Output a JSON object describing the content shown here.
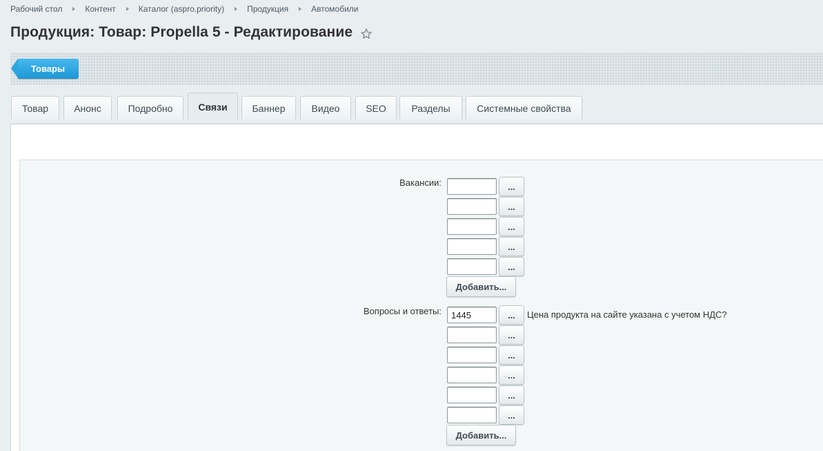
{
  "breadcrumbs": [
    "Рабочий стол",
    "Контент",
    "Каталог (aspro.priority)",
    "Продукция",
    "Автомобили"
  ],
  "page_title": "Продукция: Товар: Propella 5 - Редактирование",
  "favorite_icon": "star-icon",
  "toolbar": {
    "back_label": "Товары",
    "accent": "#2aa6e1"
  },
  "tabs": [
    "Товар",
    "Анонс",
    "Подробно",
    "Связи",
    "Баннер",
    "Видео",
    "SEO",
    "Разделы",
    "Системные свойства"
  ],
  "active_tab": "Связи",
  "fields": {
    "vacancies": {
      "label": "Вакансии:",
      "values": [
        "",
        "",
        "",
        "",
        ""
      ],
      "browse_label": "...",
      "add_label": "Добавить..."
    },
    "faq": {
      "label": "Вопросы и ответы:",
      "values": [
        "1445",
        "",
        "",
        "",
        "",
        ""
      ],
      "linked_names": [
        "Цена продукта на сайте указана с учетом НДС?"
      ],
      "browse_label": "...",
      "add_label": "Добавить..."
    }
  }
}
